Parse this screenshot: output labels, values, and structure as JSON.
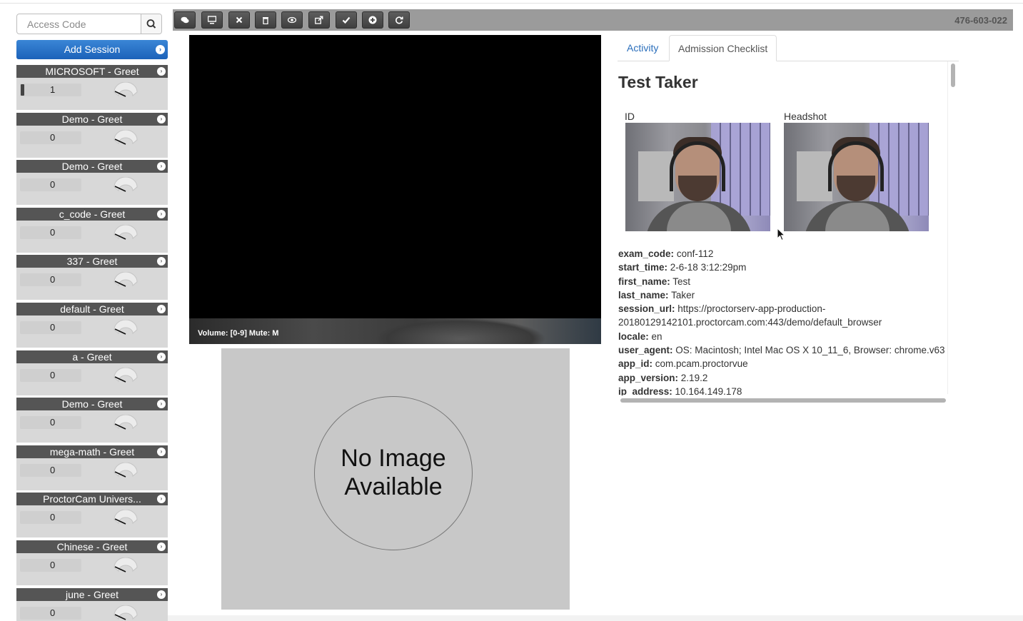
{
  "sidebar": {
    "search_placeholder": "Access Code",
    "add_session_label": "Add Session",
    "sessions": [
      {
        "title": "MICROSOFT - Greet",
        "count": "1"
      },
      {
        "title": "Demo - Greet",
        "count": "0"
      },
      {
        "title": "Demo - Greet",
        "count": "0"
      },
      {
        "title": "c_code - Greet",
        "count": "0"
      },
      {
        "title": "337 - Greet",
        "count": "0"
      },
      {
        "title": "default - Greet",
        "count": "0"
      },
      {
        "title": "a - Greet",
        "count": "0"
      },
      {
        "title": "Demo - Greet",
        "count": "0"
      },
      {
        "title": "mega-math - Greet",
        "count": "0"
      },
      {
        "title": "ProctorCam Univers...",
        "count": "0"
      },
      {
        "title": "Chinese - Greet",
        "count": "0"
      },
      {
        "title": "june - Greet",
        "count": "0"
      }
    ]
  },
  "toolbar": {
    "session_id": "476-603-022",
    "buttons": [
      "chat-icon",
      "monitor-icon",
      "close-icon",
      "trash-icon",
      "eye-icon",
      "share-icon",
      "check-icon",
      "plus-circle-icon",
      "refresh-icon"
    ]
  },
  "video": {
    "volume_label": "Volume: [0-9] Mute: M"
  },
  "no_image": {
    "line1": "No Image",
    "line2": "Available"
  },
  "tabs": [
    {
      "label": "Activity"
    },
    {
      "label": "Admission Checklist"
    }
  ],
  "checklist": {
    "name": "Test Taker",
    "id_label": "ID",
    "headshot_label": "Headshot",
    "fields": [
      {
        "key": "exam_code:",
        "value": "conf-112"
      },
      {
        "key": "start_time:",
        "value": "2-6-18 3:12:29pm"
      },
      {
        "key": "first_name:",
        "value": "Test"
      },
      {
        "key": "last_name:",
        "value": "Taker"
      },
      {
        "key": "session_url:",
        "value": "https://proctorserv-app-production-"
      },
      {
        "key": "",
        "value": "20180129142101.proctorcam.com:443/demo/default_browser"
      },
      {
        "key": "locale:",
        "value": "en"
      },
      {
        "key": "user_agent:",
        "value": "OS: Macintosh; Intel Mac OS X 10_11_6, Browser: chrome.v63"
      },
      {
        "key": "app_id:",
        "value": "com.pcam.proctorvue"
      },
      {
        "key": "app_version:",
        "value": "2.19.2"
      },
      {
        "key": "ip_address:",
        "value": "10.164.149.178"
      }
    ]
  },
  "colors": {
    "accent": "#1c62b9",
    "session_header": "#555555",
    "toolbar": "#9b9b9b"
  }
}
